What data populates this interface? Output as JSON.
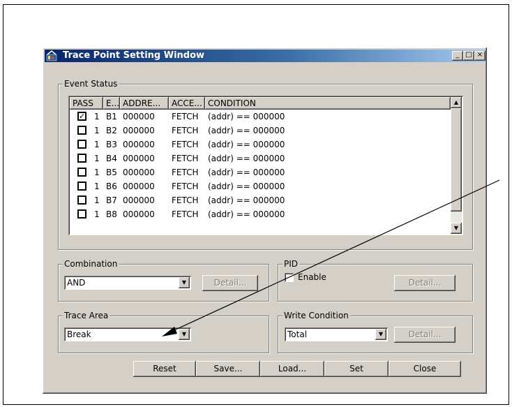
{
  "window": {
    "title": "Trace Point Setting Window",
    "minimize": "_",
    "maximize": "□",
    "close": "×"
  },
  "event_status": {
    "label": "Event Status",
    "columns": [
      "PASS",
      "E...",
      "ADDRE...",
      "ACCE...",
      "CONDITION"
    ],
    "rows": [
      {
        "checked": true,
        "pass": "1",
        "event": "B1",
        "address": "000000",
        "access": "FETCH",
        "condition": "(addr) == 000000"
      },
      {
        "checked": false,
        "pass": "1",
        "event": "B2",
        "address": "000000",
        "access": "FETCH",
        "condition": "(addr) == 000000"
      },
      {
        "checked": false,
        "pass": "1",
        "event": "B3",
        "address": "000000",
        "access": "FETCH",
        "condition": "(addr) == 000000"
      },
      {
        "checked": false,
        "pass": "1",
        "event": "B4",
        "address": "000000",
        "access": "FETCH",
        "condition": "(addr) == 000000"
      },
      {
        "checked": false,
        "pass": "1",
        "event": "B5",
        "address": "000000",
        "access": "FETCH",
        "condition": "(addr) == 000000"
      },
      {
        "checked": false,
        "pass": "1",
        "event": "B6",
        "address": "000000",
        "access": "FETCH",
        "condition": "(addr) == 000000"
      },
      {
        "checked": false,
        "pass": "1",
        "event": "B7",
        "address": "000000",
        "access": "FETCH",
        "condition": "(addr) == 000000"
      },
      {
        "checked": false,
        "pass": "1",
        "event": "B8",
        "address": "000000",
        "access": "FETCH",
        "condition": "(addr) == 000000"
      }
    ]
  },
  "combination": {
    "label": "Combination",
    "value": "AND",
    "detail": "Detail..."
  },
  "pid": {
    "label": "PID",
    "enable_label": "Enable",
    "enabled": false,
    "detail": "Detail..."
  },
  "trace_area": {
    "label": "Trace Area",
    "value": "Break"
  },
  "write_condition": {
    "label": "Write Condition",
    "value": "Total",
    "detail": "Detail..."
  },
  "buttons": {
    "reset": "Reset",
    "save": "Save...",
    "load": "Load...",
    "set": "Set",
    "close": "Close"
  },
  "icons": {
    "app": "trace-app-icon",
    "check": "✓",
    "down": "▼",
    "up": "▲"
  }
}
